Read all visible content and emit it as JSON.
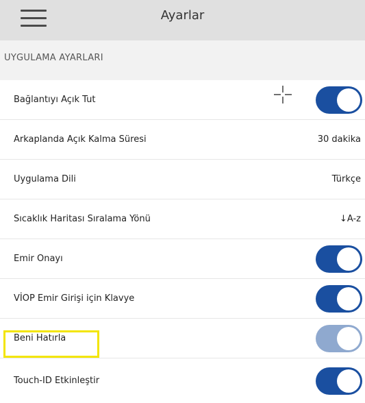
{
  "header": {
    "title": "Ayarlar"
  },
  "section": {
    "title": "UYGULAMA AYARLARI"
  },
  "rows": [
    {
      "label": "Bağlantıyı Açık Tut",
      "toggle": "on"
    },
    {
      "label": "Arkaplanda Açık Kalma Süresi",
      "value": "30 dakika"
    },
    {
      "label": "Uygulama Dili",
      "value": "Türkçe"
    },
    {
      "label": "Sıcaklık Haritası Sıralama Yönü",
      "value": "↓A-z"
    },
    {
      "label": "Emir Onayı",
      "toggle": "on"
    },
    {
      "label": "VİOP Emir Girişi için Klavye",
      "toggle": "on"
    },
    {
      "label": "Beni Hatırla",
      "toggle": "on-disabled"
    },
    {
      "label": "Touch-ID Etkinleştir",
      "toggle": "on"
    }
  ],
  "colors": {
    "toggle_on": "#1a4fa0",
    "toggle_disabled": "#8fa9cf",
    "highlight": "#f3e500",
    "header_bg": "#e0e0e0"
  },
  "icons": {
    "menu": "hamburger-menu-icon",
    "cursor": "crosshair-icon"
  }
}
